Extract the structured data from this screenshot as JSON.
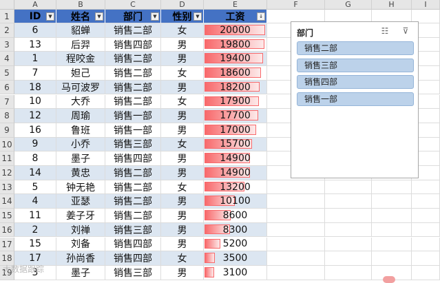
{
  "columns": [
    "A",
    "B",
    "C",
    "D",
    "E",
    "F",
    "G",
    "H",
    "I"
  ],
  "header": {
    "id": "ID",
    "name": "姓名",
    "dept": "部门",
    "gender": "性别",
    "salary": "工资"
  },
  "row_numbers": [
    "1",
    "2",
    "3",
    "4",
    "5",
    "6",
    "7",
    "8",
    "9",
    "10",
    "11",
    "12",
    "13",
    "14",
    "15",
    "16",
    "17",
    "18",
    "19"
  ],
  "salary_max": 20000,
  "rows": [
    {
      "id": "6",
      "name": "貂蝉",
      "dept": "销售二部",
      "gender": "女",
      "salary": "20000",
      "value": 20000
    },
    {
      "id": "13",
      "name": "后羿",
      "dept": "销售四部",
      "gender": "男",
      "salary": "19800",
      "value": 19800
    },
    {
      "id": "1",
      "name": "程咬金",
      "dept": "销售二部",
      "gender": "男",
      "salary": "19400",
      "value": 19400
    },
    {
      "id": "7",
      "name": "妲己",
      "dept": "销售二部",
      "gender": "女",
      "salary": "18600",
      "value": 18600
    },
    {
      "id": "18",
      "name": "马可波罗",
      "dept": "销售二部",
      "gender": "男",
      "salary": "18200",
      "value": 18200
    },
    {
      "id": "10",
      "name": "大乔",
      "dept": "销售二部",
      "gender": "女",
      "salary": "17900",
      "value": 17900
    },
    {
      "id": "12",
      "name": "周瑜",
      "dept": "销售一部",
      "gender": "男",
      "salary": "17700",
      "value": 17700
    },
    {
      "id": "16",
      "name": "鲁班",
      "dept": "销售一部",
      "gender": "男",
      "salary": "17000",
      "value": 17000
    },
    {
      "id": "9",
      "name": "小乔",
      "dept": "销售三部",
      "gender": "女",
      "salary": "15700",
      "value": 15700
    },
    {
      "id": "8",
      "name": "墨子",
      "dept": "销售四部",
      "gender": "男",
      "salary": "14900",
      "value": 14900
    },
    {
      "id": "14",
      "name": "黄忠",
      "dept": "销售二部",
      "gender": "男",
      "salary": "14900",
      "value": 14900
    },
    {
      "id": "5",
      "name": "钟无艳",
      "dept": "销售二部",
      "gender": "女",
      "salary": "13200",
      "value": 13200
    },
    {
      "id": "4",
      "name": "亚瑟",
      "dept": "销售二部",
      "gender": "男",
      "salary": "10100",
      "value": 10100
    },
    {
      "id": "11",
      "name": "姜子牙",
      "dept": "销售二部",
      "gender": "男",
      "salary": "8600",
      "value": 8600
    },
    {
      "id": "2",
      "name": "刘禅",
      "dept": "销售三部",
      "gender": "男",
      "salary": "8300",
      "value": 8300
    },
    {
      "id": "15",
      "name": "刘备",
      "dept": "销售四部",
      "gender": "男",
      "salary": "5200",
      "value": 5200
    },
    {
      "id": "17",
      "name": "孙尚香",
      "dept": "销售四部",
      "gender": "女",
      "salary": "3500",
      "value": 3500
    },
    {
      "id": "3",
      "name": "墨子",
      "dept": "销售三部",
      "gender": "男",
      "salary": "3100",
      "value": 3100
    }
  ],
  "slicer": {
    "title": "部门",
    "multiselect_icon": "☷",
    "clear_filter_icon": "⊽",
    "items": [
      "销售二部",
      "销售三部",
      "销售四部",
      "销售一部"
    ]
  },
  "watermark": "大数据跟踪",
  "colors": {
    "header": "#4472c4",
    "band": "#dce6f1",
    "bar": "#f8696b",
    "slicer_item": "#bcd2ea"
  }
}
